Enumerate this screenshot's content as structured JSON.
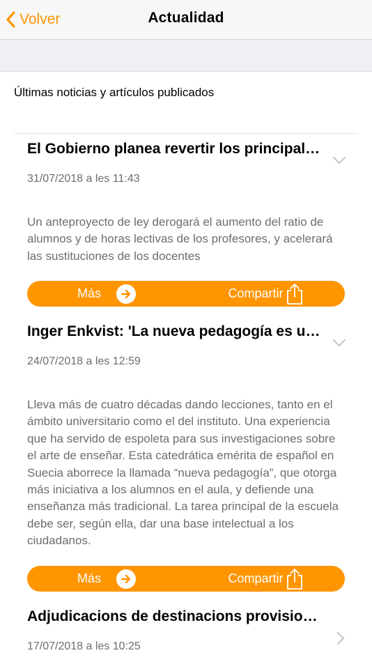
{
  "nav": {
    "back_label": "Volver",
    "title": "Actualidad"
  },
  "subtitle": "Últimas noticias y artículos publicados",
  "actions": {
    "more_label": "Más",
    "share_label": "Compartir"
  },
  "articles": [
    {
      "title": "El Gobierno planea revertir los principales recortes en educación",
      "date": "31/07/2018 a les 11:43",
      "body": "Un anteproyecto de ley derogará el aumento del ratio de alumnos y de horas lectivas de los profesores, y acelerará las sustituciones de los docentes"
    },
    {
      "title": "Inger Enkvist: 'La nueva pedagogía es un fracaso'",
      "date": "24/07/2018 a les 12:59",
      "body": "Lleva más de cuatro décadas dando lecciones, tanto en el ámbito universitario como el del instituto. Una experiencia que ha servido de espoleta para sus investigaciones sobre el arte de enseñar. Esta catedrática emérita de español en Suecia aborrece la llamada “nueva pedagogía”, que otorga más iniciativa a los alumnos en el aula, y defiende una enseñanza más tradicional. La tarea principal de la escuela debe ser, según ella, dar una base intelectual a los ciudadanos."
    },
    {
      "title": "Adjudicacions de destinacions provisionals",
      "date": "17/07/2018 a les 10:25"
    }
  ],
  "colors": {
    "accent": "#ff9500",
    "secondary_text": "#6d6d72"
  }
}
